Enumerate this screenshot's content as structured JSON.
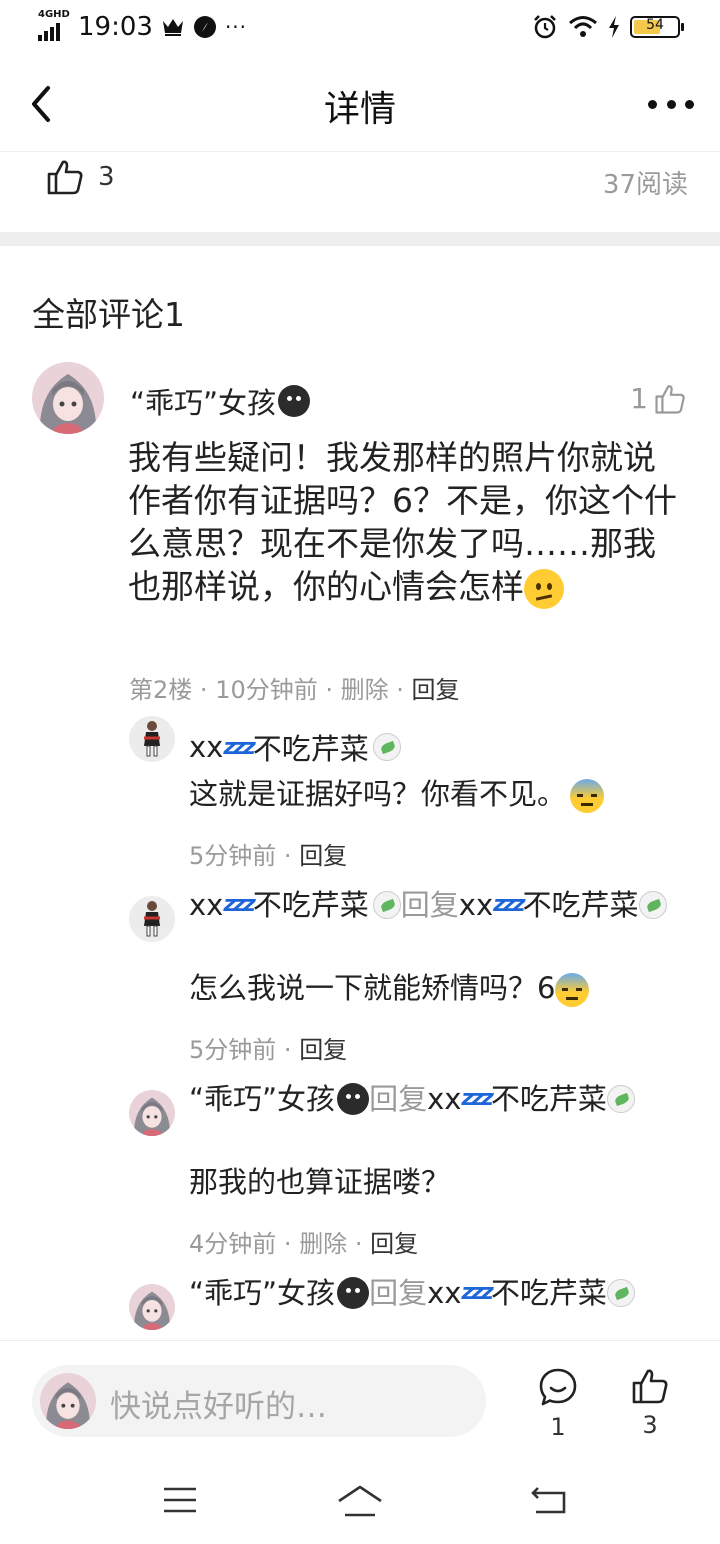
{
  "status_bar": {
    "network": "4GHD",
    "time": "19:03",
    "more": "···",
    "battery": "54"
  },
  "nav": {
    "title": "详情"
  },
  "stats": {
    "like_count": "3",
    "read_count": "37阅读"
  },
  "comments_section": {
    "title": "全部评论1"
  },
  "main_comment": {
    "author": "“乖巧”女孩",
    "like_count": "1",
    "text": "我有些疑问！我发那样的照片你就说作者你有证据吗？6？不是，你这个什么意思？现在不是你发了吗……那我也那样说，你的心情会怎样",
    "floor": "第2楼",
    "time": "10分钟前",
    "delete": "删除",
    "reply": "回复"
  },
  "replies": [
    {
      "author": "xx",
      "author_suffix": "不吃芹菜",
      "text": "这就是证据好吗？你看不见。",
      "time": "5分钟前",
      "reply": "回复"
    },
    {
      "author": "xx",
      "author_suffix": "不吃芹菜",
      "reply_word": "回复",
      "target": "xx",
      "target_suffix": "不吃芹菜",
      "text": "怎么我说一下就能矫情吗？6",
      "time": "5分钟前",
      "reply": "回复"
    },
    {
      "author": "“乖巧”女孩",
      "reply_word": "回复",
      "target": "xx",
      "target_suffix": "不吃芹菜",
      "text": "那我的也算证据喽？",
      "time": "4分钟前",
      "delete": "删除",
      "reply": "回复"
    },
    {
      "author": "“乖巧”女孩",
      "reply_word": "回复",
      "target": "xx",
      "target_suffix": "不吃芹菜"
    }
  ],
  "bottom_bar": {
    "input_placeholder": "快说点好听的…",
    "comment_count": "1",
    "like_count": "3"
  },
  "icons": {
    "back": "chevron-left-icon",
    "more": "more-dots-icon",
    "thumb": "thumbs-up-icon",
    "comment": "chat-bubble-icon",
    "menu": "menu-icon",
    "home": "home-icon",
    "return": "return-icon"
  },
  "colors": {
    "muted": "#9a9a9a",
    "text": "#222222",
    "divider": "#eeeeee",
    "zzz_blue": "#1e66d8",
    "leaf_green": "#5fb65f",
    "battery_yellow": "#f2c94c"
  }
}
